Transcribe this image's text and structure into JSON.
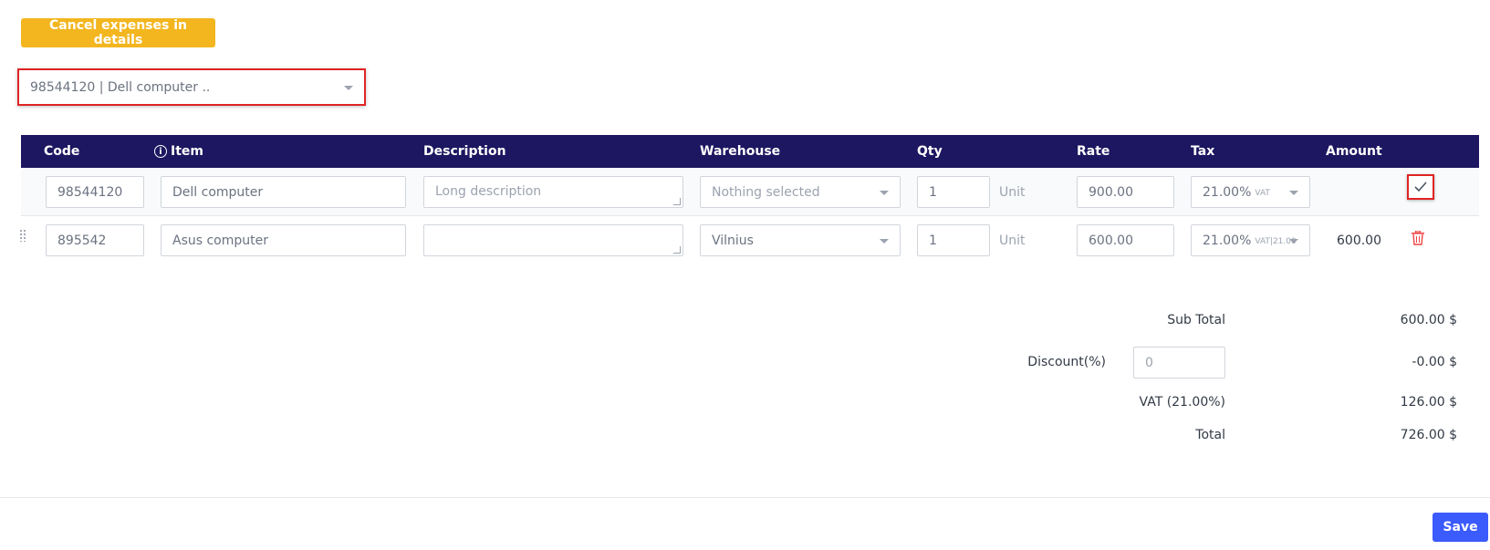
{
  "toolbar": {
    "cancel_label": "Cancel expenses in details"
  },
  "item_select": {
    "value": "98544120 | Dell computer ..",
    "icon": "chevron-down-icon"
  },
  "table": {
    "headers": {
      "code": "Code",
      "item": "Item",
      "description": "Description",
      "warehouse": "Warehouse",
      "qty": "Qty",
      "rate": "Rate",
      "tax": "Tax",
      "amount": "Amount"
    },
    "item_header_icon": "info-icon",
    "rows": [
      {
        "code": "98544120",
        "item": "Dell computer",
        "description": "",
        "description_placeholder": "Long description",
        "warehouse": "Nothing selected",
        "qty": "1",
        "unit": "Unit",
        "rate": "900.00",
        "tax_rate": "21.00%",
        "tax_name": "VAT",
        "amount": "",
        "action_icon": "check-icon"
      },
      {
        "code": "895542",
        "item": "Asus computer",
        "description": "",
        "description_placeholder": "",
        "warehouse": "Vilnius",
        "qty": "1",
        "unit": "Unit",
        "rate": "600.00",
        "tax_rate": "21.00%",
        "tax_name": "VAT|21.00",
        "amount": "600.00",
        "action_icon": "trash-icon"
      }
    ]
  },
  "summary": {
    "subtotal_label": "Sub Total",
    "subtotal_value": "600.00 $",
    "discount_label": "Discount(%)",
    "discount_input_value": "0",
    "discount_value": "-0.00 $",
    "vat_label": "VAT (21.00%)",
    "vat_value": "126.00 $",
    "total_label": "Total",
    "total_value": "726.00 $"
  },
  "footer": {
    "save_label": "Save"
  },
  "colors": {
    "header_bg": "#1c1760",
    "cancel_btn": "#f3b61f",
    "save_btn": "#3b5bfd",
    "highlight_border": "#e02424",
    "delete_icon": "#ef4444"
  }
}
